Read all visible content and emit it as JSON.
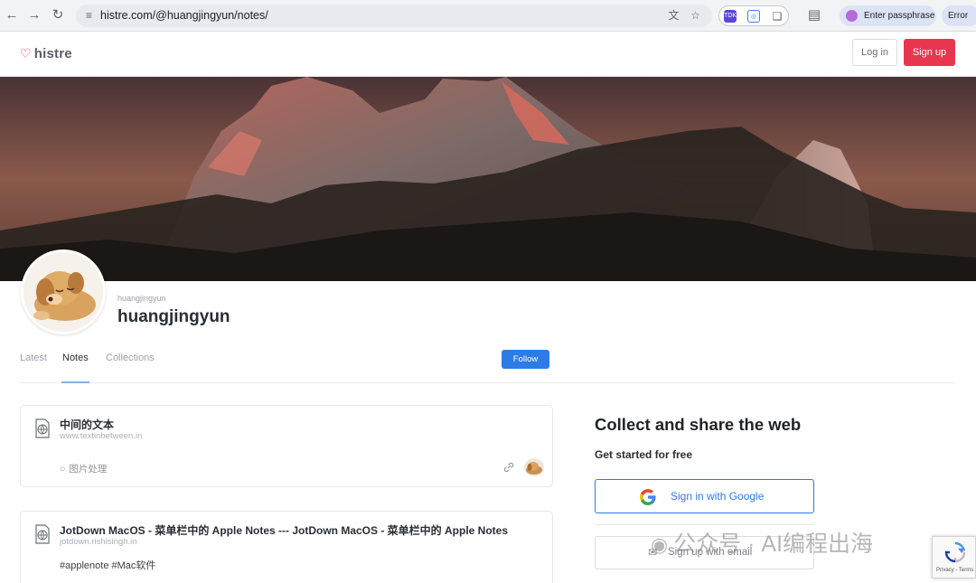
{
  "browser": {
    "url": "histre.com/@huangjingyun/notes/",
    "passphrase_label": "Enter passphrase",
    "error_label": "Error",
    "extension_label": "TDK"
  },
  "header": {
    "logo_text": "histre",
    "login_label": "Log in",
    "signup_label": "Sign up",
    "brand_color": "#e8364f"
  },
  "profile": {
    "handle_small": "huangjingyun",
    "handle_big": "huangjingyun",
    "follow_label": "Follow"
  },
  "tabs": [
    {
      "label": "Latest",
      "active": false
    },
    {
      "label": "Notes",
      "active": true
    },
    {
      "label": "Collections",
      "active": false
    }
  ],
  "notes": [
    {
      "title": "中间的文本",
      "url": "www.textinbetween.in",
      "tag": "图片处理"
    },
    {
      "title": "JotDown MacOS - 菜单栏中的 Apple Notes --- JotDown MacOS - 菜单栏中的 Apple Notes",
      "url": "jotdown.rishisingh.in",
      "body": "#applenote #Mac软件"
    }
  ],
  "sidebar": {
    "title": "Collect and share the web",
    "subtitle": "Get started for free",
    "google_label": "Sign in with Google",
    "email_label": "Sign up with email",
    "accent_color": "#2d7be6"
  },
  "watermark": {
    "text": "公众号 · AI编程出海"
  },
  "recaptcha": {
    "links": "Privacy - Terms"
  }
}
